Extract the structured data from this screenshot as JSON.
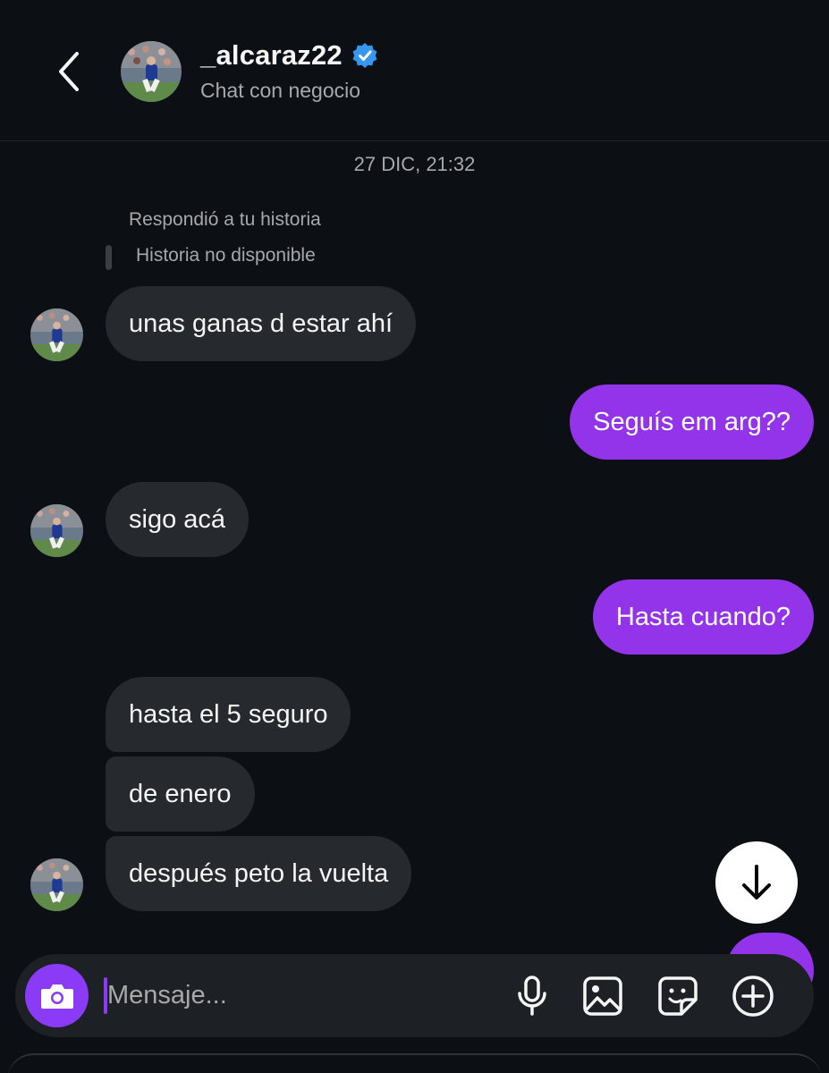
{
  "header": {
    "username": "_alcaraz22",
    "subtitle": "Chat con negocio",
    "verified": true,
    "icons": {
      "back": "chevron-left-icon",
      "verified": "verified-badge-icon"
    }
  },
  "thread": {
    "timestamp": "27 DIC, 21:32",
    "story_reply": {
      "label": "Respondió a tu historia",
      "story_status": "Historia no disponible"
    },
    "messages": [
      {
        "side": "in",
        "text": "unas ganas d estar ahí"
      },
      {
        "side": "out",
        "text": "Seguís em arg??"
      },
      {
        "side": "in",
        "text": "sigo acá"
      },
      {
        "side": "out",
        "text": "Hasta cuando?"
      },
      {
        "side": "in",
        "text": "hasta el 5 seguro"
      },
      {
        "side": "in",
        "text": "de enero"
      },
      {
        "side": "in",
        "text": "después peto la vuelta"
      }
    ]
  },
  "composer": {
    "placeholder": "Mensaje...",
    "icons": [
      "camera-icon",
      "microphone-icon",
      "image-icon",
      "sticker-icon",
      "plus-circle-icon"
    ]
  },
  "colors": {
    "background": "#0c1014",
    "incoming_bubble": "#26292e",
    "outgoing_bubble": "#9333ea",
    "accent": "#8b3bf5",
    "verified": "#3797f0",
    "muted_text": "#a8a8a8"
  }
}
